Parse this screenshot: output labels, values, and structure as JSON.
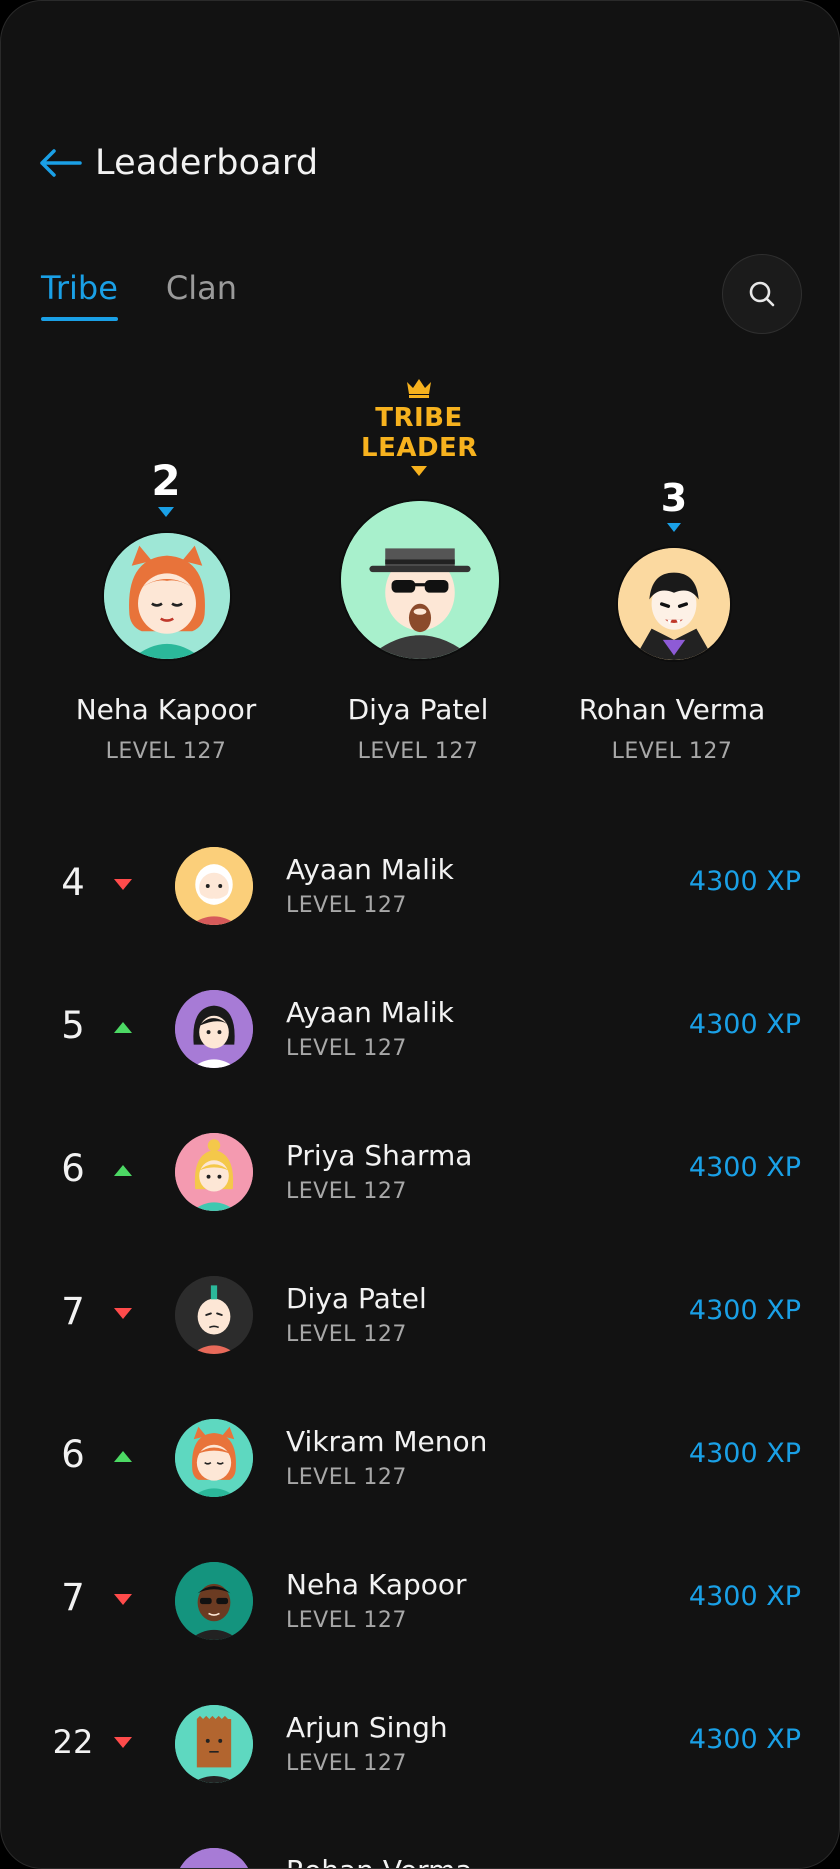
{
  "header": {
    "title": "Leaderboard"
  },
  "tabs": [
    {
      "label": "Tribe"
    },
    {
      "label": "Clan"
    }
  ],
  "leader_badge": {
    "line1": "TRIBE",
    "line2": "LEADER"
  },
  "podium": [
    {
      "rank": "2",
      "name": "Neha Kapoor",
      "level": "LEVEL 127",
      "trend": "down"
    },
    {
      "rank": "",
      "name": "Diya Patel",
      "level": "LEVEL 127",
      "trend": "down"
    },
    {
      "rank": "3",
      "name": "Rohan Verma",
      "level": "LEVEL 127",
      "trend": "down"
    }
  ],
  "list": [
    {
      "rank": "4",
      "trend": "down",
      "name": "Ayaan Malik",
      "level": "LEVEL 127",
      "xp": "4300 XP"
    },
    {
      "rank": "5",
      "trend": "up",
      "name": "Ayaan Malik",
      "level": "LEVEL 127",
      "xp": "4300 XP"
    },
    {
      "rank": "6",
      "trend": "up",
      "name": "Priya Sharma",
      "level": "LEVEL 127",
      "xp": "4300 XP"
    },
    {
      "rank": "7",
      "trend": "down",
      "name": "Diya Patel",
      "level": "LEVEL 127",
      "xp": "4300 XP"
    },
    {
      "rank": "6",
      "trend": "up",
      "name": "Vikram Menon",
      "level": "LEVEL 127",
      "xp": "4300 XP"
    },
    {
      "rank": "7",
      "trend": "down",
      "name": "Neha Kapoor",
      "level": "LEVEL 127",
      "xp": "4300 XP"
    },
    {
      "rank": "22",
      "trend": "down",
      "name": "Arjun Singh",
      "level": "LEVEL 127",
      "xp": "4300 XP"
    },
    {
      "name": "Rohan Verma"
    }
  ],
  "colors": {
    "accent": "#1aa0e6",
    "gold": "#f7b21e",
    "up": "#4cd964",
    "down": "#ff4b4b",
    "background": "#121212"
  }
}
